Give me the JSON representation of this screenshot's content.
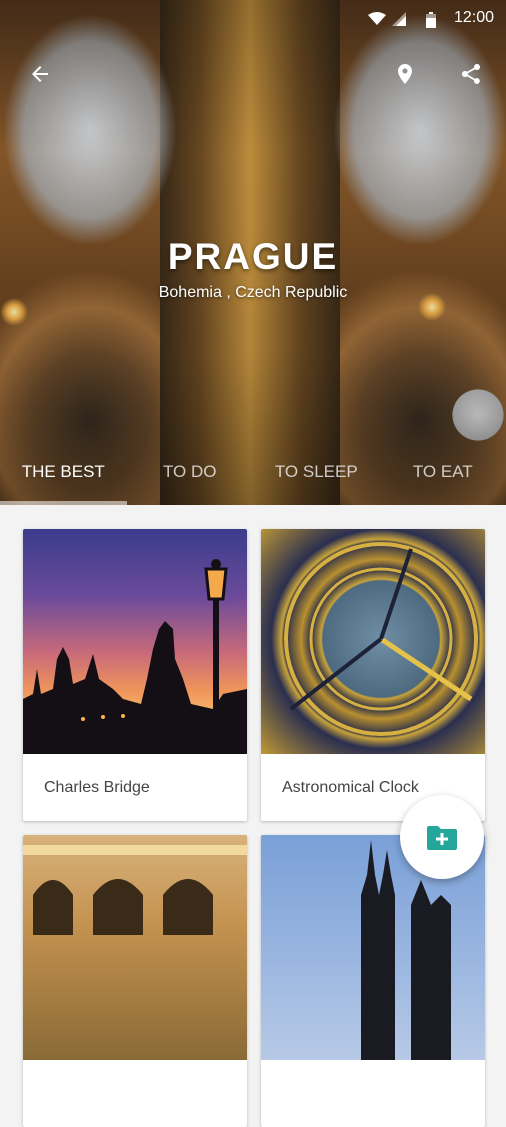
{
  "status_bar": {
    "time": "12:00"
  },
  "hero": {
    "city": "PRAGUE",
    "region": "Bohemia , Czech Republic"
  },
  "tabs": [
    {
      "label": "THE BEST",
      "active": true
    },
    {
      "label": "TO DO",
      "active": false
    },
    {
      "label": "TO SLEEP",
      "active": false
    },
    {
      "label": "TO EAT",
      "active": false
    }
  ],
  "cards": [
    {
      "label": "Charles Bridge"
    },
    {
      "label": "Astronomical Clock"
    },
    {
      "label": ""
    },
    {
      "label": ""
    }
  ],
  "icons": {
    "back": "arrow-back-icon",
    "location": "location-pin-icon",
    "share": "share-icon",
    "fab": "add-folder-icon"
  },
  "colors": {
    "accent": "#26a69a",
    "background": "#f3f3f3"
  }
}
